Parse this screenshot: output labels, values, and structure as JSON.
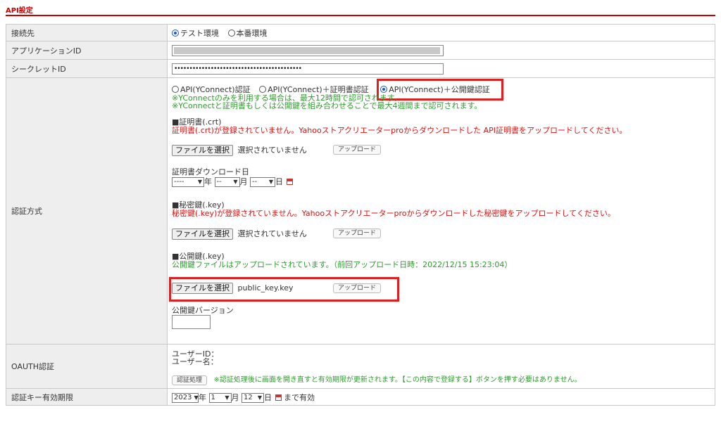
{
  "section": {
    "title": "API設定"
  },
  "rows": {
    "connection": {
      "label": "接続先",
      "options": [
        "テスト環境",
        "本番環境"
      ],
      "selected": "テスト環境"
    },
    "app_id": {
      "label": "アプリケーションID"
    },
    "secret_id": {
      "label": "シークレットID",
      "masked_value": "••••••••••••••••••••••••••••••••••••••••••"
    },
    "auth_method": {
      "label": "認証方式",
      "options": [
        "API(YConnect)認証",
        "API(YConnect)＋証明書認証",
        "API(YConnect)＋公開鍵認証"
      ],
      "selected": "API(YConnect)＋公開鍵認証",
      "notes": [
        "※YConnectのみを利用する場合は、最大12時間で認可されます。",
        "※YConnectと証明書もしくは公開鍵を組み合わせることで最大4週間まで認可されます。"
      ],
      "cert": {
        "title": "■証明書(.crt)",
        "status": "証明書(.crt)が登録されていません。Yahooストアクリエーターproからダウンロードした API証明書をアップロードしてください。",
        "choose_label": "ファイルを選択",
        "file_status": "選択されていません",
        "upload_label": "アップロード"
      },
      "cert_download_date": {
        "label": "証明書ダウンロード日",
        "year": "----",
        "year_unit": "年",
        "month": "--",
        "month_unit": "月",
        "day": "--",
        "day_unit": "日"
      },
      "private_key": {
        "title": "■秘密鍵(.key)",
        "status": "秘密鍵(.key)が登録されていません。Yahooストアクリエーターproからダウンロードした秘密鍵をアップロードしてください。",
        "choose_label": "ファイルを選択",
        "file_status": "選択されていません",
        "upload_label": "アップロード"
      },
      "public_key": {
        "title": "■公開鍵(.key)",
        "status": "公開鍵ファイルはアップロードされています。（前回アップロード日時：2022/12/15 15:23:04）",
        "choose_label": "ファイルを選択",
        "file_name": "public_key.key",
        "upload_label": "アップロード"
      },
      "public_key_version": {
        "label": "公開鍵バージョン",
        "value": ""
      }
    },
    "oauth": {
      "label": "OAUTH認証",
      "user_id": "ユーザーID：",
      "user_name": "ユーザー名：",
      "button_label": "認証処理",
      "note": "※認証処理後に画面を開き直すと有効期限が更新されます。【この内容で登録する】ボタンを押す必要はありません。"
    },
    "expiry": {
      "label": "認証キー有効期限",
      "year": "2023",
      "year_unit": "年",
      "month": "1",
      "month_unit": "月",
      "day": "12",
      "day_unit": "日",
      "suffix": "まで有効"
    }
  },
  "colors": {
    "accent": "#cc0000",
    "highlight": "#e02020",
    "note_green": "#2e9a2e",
    "error_red": "#e01010"
  }
}
